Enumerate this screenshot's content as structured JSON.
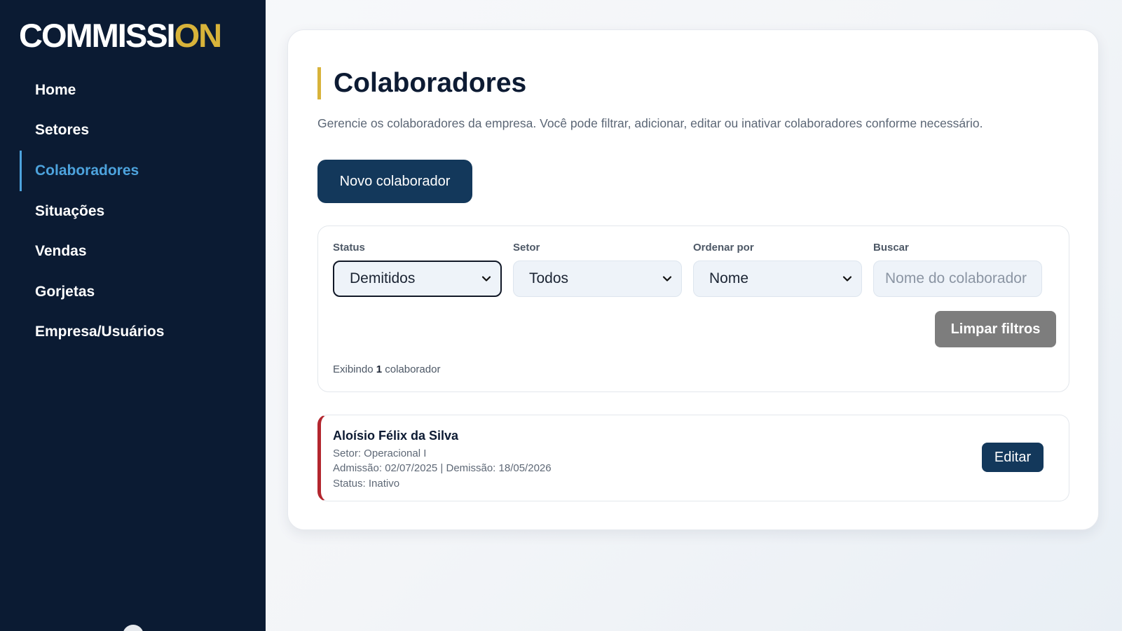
{
  "brand": {
    "logo_main": "COMMISSI",
    "logo_accent": "ON",
    "accent_color": "#d8b33a"
  },
  "sidebar": {
    "items": [
      {
        "label": "Home",
        "active": false
      },
      {
        "label": "Setores",
        "active": false
      },
      {
        "label": "Colaboradores",
        "active": true
      },
      {
        "label": "Situações",
        "active": false
      },
      {
        "label": "Vendas",
        "active": false
      },
      {
        "label": "Gorjetas",
        "active": false
      },
      {
        "label": "Empresa/Usuários",
        "active": false
      }
    ]
  },
  "page": {
    "title": "Colaboradores",
    "description": "Gerencie os colaboradores da empresa. Você pode filtrar, adicionar, editar ou inativar colaboradores conforme necessário.",
    "new_button": "Novo colaborador"
  },
  "filters": {
    "status": {
      "label": "Status",
      "value": "Demitidos"
    },
    "setor": {
      "label": "Setor",
      "value": "Todos"
    },
    "ordenar": {
      "label": "Ordenar por",
      "value": "Nome"
    },
    "buscar": {
      "label": "Buscar",
      "placeholder": "Nome do colaborador",
      "value": ""
    },
    "clear_button": "Limpar filtros",
    "count_prefix": "Exibindo ",
    "count_number": "1",
    "count_suffix": " colaborador"
  },
  "employees": [
    {
      "name": "Aloísio Félix da Silva",
      "setor": "Setor: Operacional I",
      "dates": "Admissão: 02/07/2025 | Demissão: 18/05/2026",
      "status": "Status: Inativo",
      "edit_label": "Editar",
      "status_color": "#b3262e"
    }
  ]
}
